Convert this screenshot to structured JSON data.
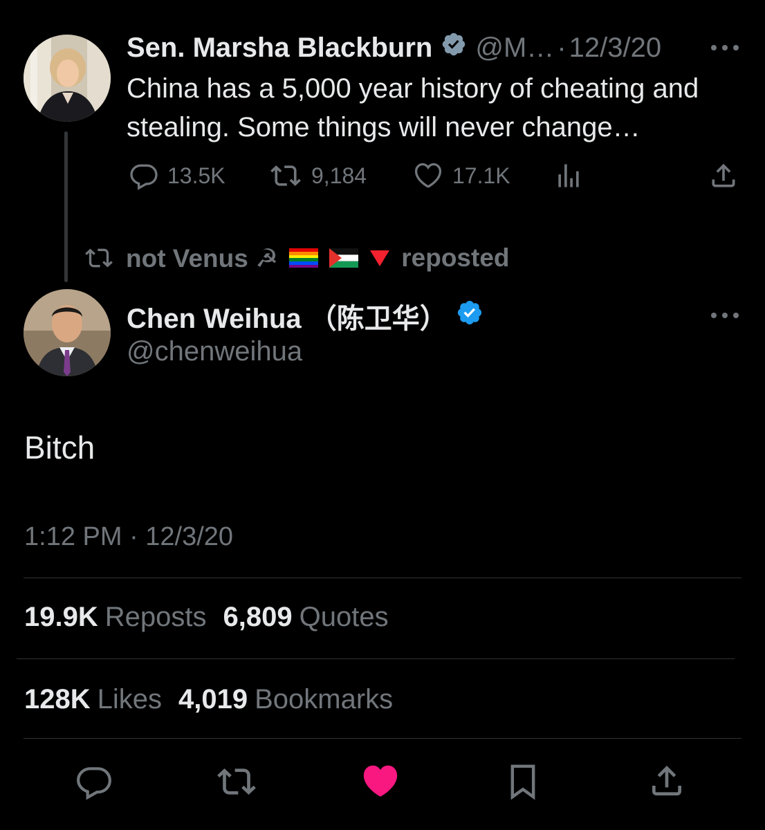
{
  "parent_tweet": {
    "author_name": "Sen. Marsha Blackburn",
    "handle": "@M…",
    "date": "12/3/20",
    "text": "China has a 5,000 year history of cheating and stealing. Some things will never change…",
    "replies": "13.5K",
    "reposts": "9,184",
    "likes": "17.1K"
  },
  "repost_banner": {
    "user": "not Venus ☭",
    "label": "reposted"
  },
  "main_tweet": {
    "author_name": "Chen Weihua （陈卫华）",
    "handle": "@chenweihua",
    "text": "Bitch",
    "timestamp": "1:12 PM · 12/3/20",
    "stats": {
      "reposts_count": "19.9K",
      "reposts_label": "Reposts",
      "quotes_count": "6,809",
      "quotes_label": "Quotes",
      "likes_count": "128K",
      "likes_label": "Likes",
      "bookmarks_count": "4,019",
      "bookmarks_label": "Bookmarks"
    }
  },
  "icons": {
    "reply": "reply-icon",
    "repost": "repost-icon",
    "like": "heart-icon",
    "views": "views-icon",
    "share": "share-icon",
    "bookmark": "bookmark-icon",
    "more": "more-icon",
    "verified": "verified-badge-icon"
  },
  "colors": {
    "background": "#000000",
    "text": "#e7e9ea",
    "muted": "#71767b",
    "verified_blue": "#1d9bf0",
    "like_pink": "#f91880"
  }
}
